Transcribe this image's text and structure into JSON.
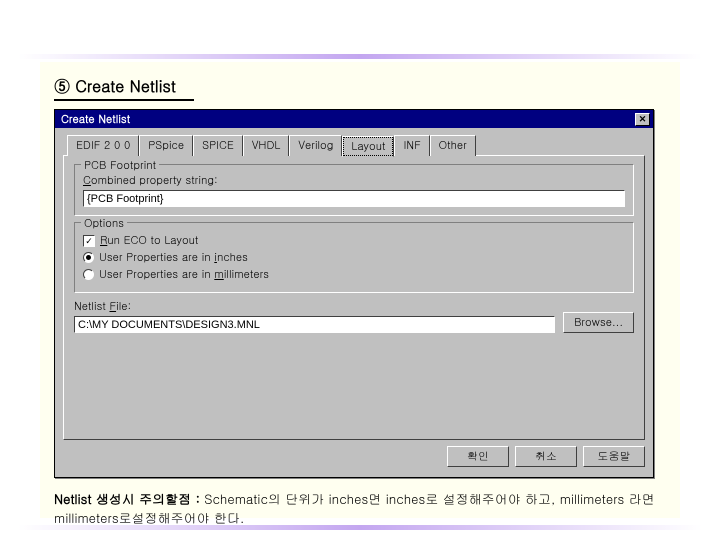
{
  "heading": "⑤ Create Netlist",
  "dialog": {
    "title": "Create Netlist",
    "close": "✕",
    "tabs": [
      "EDIF 2 0 0",
      "PSpice",
      "SPICE",
      "VHDL",
      "Verilog",
      "Layout",
      "INF",
      "Other"
    ],
    "activeTab": 5,
    "pcb": {
      "legend": "PCB Footprint",
      "comboLabel_pre": "",
      "comboLabel_u": "C",
      "comboLabel_post": "ombined property string:",
      "value": "{PCB Footprint}"
    },
    "options": {
      "legend": "Options",
      "eco_pre": "",
      "eco_u": "R",
      "eco_post": "un ECO to Layout",
      "eco_checked": "✓",
      "inches_pre": "User Properties are in ",
      "inches_u": "i",
      "inches_post": "nches",
      "mm_pre": "User Properties are in ",
      "mm_u": "m",
      "mm_post": "illimeters"
    },
    "netfile": {
      "label_pre": "Netlist ",
      "label_u": "F",
      "label_post": "ile:",
      "value": "C:\\MY DOCUMENTS\\DESIGN3.MNL",
      "browse": "Browse..."
    },
    "buttons": {
      "ok": "확인",
      "cancel": "취소",
      "help": "도움말"
    }
  },
  "note": {
    "b1": "Netlist 생성시 주의할점 :",
    "t1": " Schematic의 단위가 inches면 inches로 설정해주어야 하고, millimeters 라면 millimeters로설정해주어야 한다."
  }
}
